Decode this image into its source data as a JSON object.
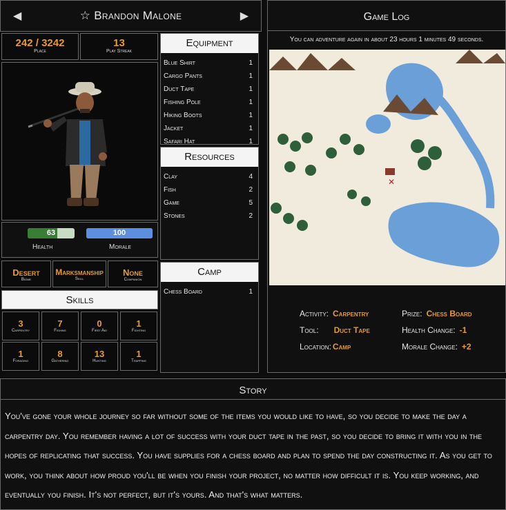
{
  "header": {
    "name": "Brandon Malone",
    "prev_icon": "triangle-left",
    "next_icon": "triangle-right",
    "star_icon": "star-outline"
  },
  "stats": {
    "place": {
      "value": "242 / 3242",
      "label": "Place"
    },
    "play_streak": {
      "value": "13",
      "label": "Play Streak"
    }
  },
  "vitals": {
    "health": {
      "value": "63",
      "fraction": 0.63,
      "label": "Health",
      "color": "#3a7d34"
    },
    "morale": {
      "value": "100",
      "fraction": 1.0,
      "label": "Morale",
      "color": "#5c8fe0"
    }
  },
  "profile": {
    "biome": {
      "value": "Desert",
      "label": "Biome"
    },
    "skill": {
      "value": "Marksmanship",
      "label": "Skill"
    },
    "companion": {
      "value": "None",
      "label": "Companion"
    }
  },
  "skills": {
    "title": "Skills",
    "items": [
      {
        "value": "3",
        "label": "Carpentry"
      },
      {
        "value": "7",
        "label": "Fishing"
      },
      {
        "value": "0",
        "label": "First Aid"
      },
      {
        "value": "1",
        "label": "Fighting"
      },
      {
        "value": "1",
        "label": "Foraging"
      },
      {
        "value": "8",
        "label": "Gathering"
      },
      {
        "value": "13",
        "label": "Hunting"
      },
      {
        "value": "1",
        "label": "Trapping"
      }
    ]
  },
  "equipment": {
    "title": "Equipment",
    "items": [
      {
        "name": "Blue Shirt",
        "qty": "1"
      },
      {
        "name": "Cargo Pants",
        "qty": "1"
      },
      {
        "name": "Duct Tape",
        "qty": "1"
      },
      {
        "name": "Fishing Pole",
        "qty": "1"
      },
      {
        "name": "Hiking Boots",
        "qty": "1"
      },
      {
        "name": "Jacket",
        "qty": "1"
      },
      {
        "name": "Safari Hat",
        "qty": "1"
      }
    ]
  },
  "resources": {
    "title": "Resources",
    "items": [
      {
        "name": "Clay",
        "qty": "4"
      },
      {
        "name": "Fish",
        "qty": "2"
      },
      {
        "name": "Game",
        "qty": "5"
      },
      {
        "name": "Stones",
        "qty": "2"
      }
    ]
  },
  "camp": {
    "title": "Camp",
    "items": [
      {
        "name": "Chess Board",
        "qty": "1"
      }
    ]
  },
  "game_log": {
    "title": "Game Log",
    "timer": "You can adventure again in about 23 hours 1 minutes 49 seconds.",
    "activity": {
      "key": "Activity:",
      "value": "Carpentry"
    },
    "tool": {
      "key": "Tool:",
      "value": "Duct Tape"
    },
    "location": {
      "key": "Location:",
      "value": "Camp"
    },
    "prize": {
      "key": "Prize:",
      "value": "Chess Board"
    },
    "health_change": {
      "key": "Health Change:",
      "value": "-1"
    },
    "morale_change": {
      "key": "Morale Change:",
      "value": "+2"
    }
  },
  "story": {
    "title": "Story",
    "text": "You've gone your whole journey so far without some of the items you would like to have, so you decide to make the day a carpentry day. You remember having a lot of success with your duct tape in the past, so you decide to bring it with you in the hopes of replicating that success. You have supplies for a chess board and plan to spend the day constructing it. As you get to work, you think about how proud you'll be when you finish your project, no matter how difficult it is. You keep working, and eventually you finish. It's not perfect, but it's yours. And that's what matters."
  }
}
